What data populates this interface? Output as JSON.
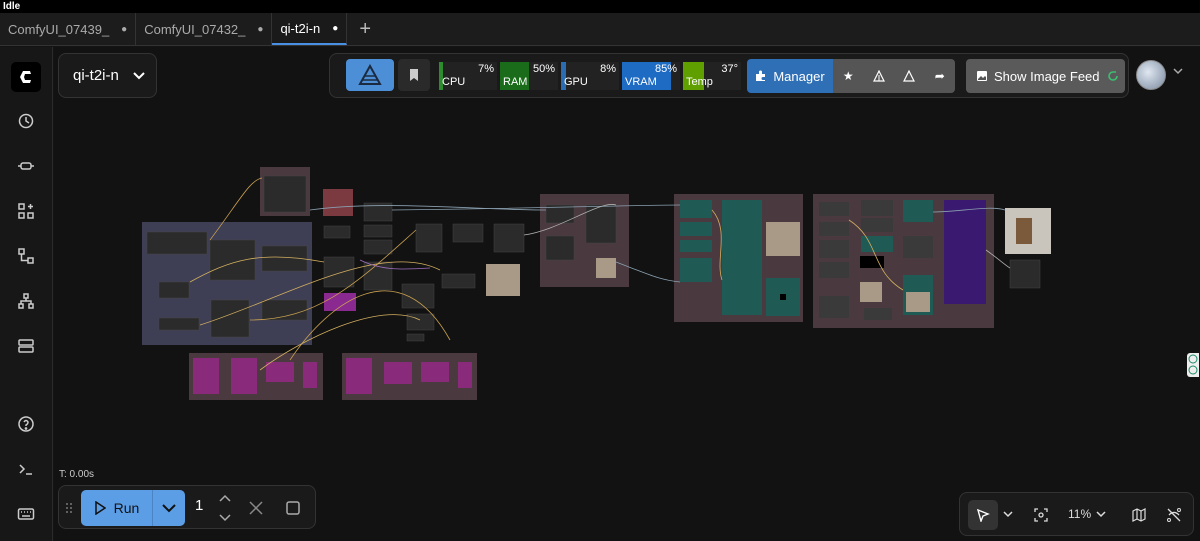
{
  "window": {
    "title": "Idle"
  },
  "tabs": [
    {
      "label": "ComfyUI_07439_",
      "active": false
    },
    {
      "label": "ComfyUI_07432_",
      "active": false
    },
    {
      "label": "qi-t2i-n",
      "active": true
    }
  ],
  "workflow": {
    "name": "qi-t2i-n"
  },
  "monitors": {
    "cpu": {
      "label": "CPU",
      "value": "7%",
      "percent": 7,
      "color": "#2e8b2e"
    },
    "ram": {
      "label": "RAM",
      "value": "50%",
      "percent": 50,
      "color": "#1a6b1a"
    },
    "gpu": {
      "label": "GPU",
      "value": "8%",
      "percent": 8,
      "color": "#2a6db5"
    },
    "vram": {
      "label": "VRAM",
      "value": "85%",
      "percent": 85,
      "color": "#1e6bc4"
    },
    "temp": {
      "label": "Temp",
      "value": "37°",
      "percent": 37,
      "color": "#5fa000"
    }
  },
  "manager": {
    "label": "Manager"
  },
  "image_feed": {
    "label": "Show Image Feed"
  },
  "run": {
    "timer": "T: 0.00s",
    "label": "Run",
    "count": "1"
  },
  "canvas": {
    "zoom": "11%"
  },
  "colors": {
    "accent": "#4d8fd6",
    "run": "#5b9ee6"
  }
}
